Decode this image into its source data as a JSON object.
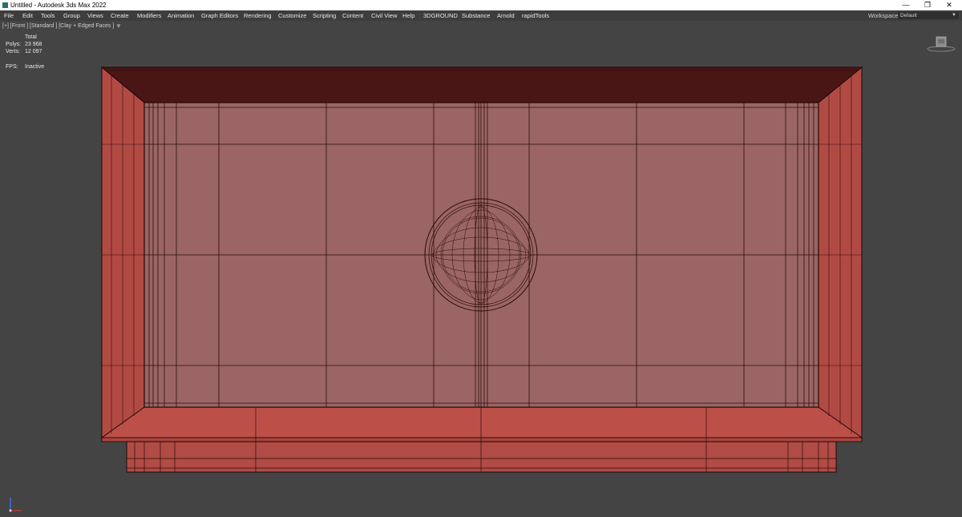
{
  "window": {
    "title": "Untitled - Autodesk 3ds Max 2022",
    "minimize_glyph": "—",
    "restore_glyph": "❐",
    "close_glyph": "✕"
  },
  "menu": {
    "items": [
      "File",
      "Edit",
      "Tools",
      "Group",
      "Views",
      "Create",
      "Modifiers",
      "Animation",
      "Graph Editors",
      "Rendering",
      "Customize",
      "Scripting",
      "Content",
      "Civil View",
      "Help",
      "3DGROUND",
      "Substance",
      "Arnold",
      "rapidTools"
    ],
    "workspaces_label": "Workspaces:",
    "workspace_value": "Default"
  },
  "viewport": {
    "label": "[+] [Front ] [Standard ] [Clay + Edged Faces ]",
    "filter_icon": "funnel-icon",
    "stats": {
      "total_label": "Total",
      "polys_label": "Polys:",
      "polys_value": "23 968",
      "verts_label": "Verts:",
      "verts_value": "12 097",
      "fps_label": "FPS:",
      "fps_value": "Inactive"
    },
    "viewcube_icon": "viewcube-icon",
    "axis_icon": "axis-tripod-icon"
  },
  "colors": {
    "viewport_bg": "#444444",
    "mesh_fill": "#9a6565",
    "mesh_dark": "#4a1a18",
    "mesh_side": "#b04c45",
    "wire": "#2a0c0a"
  }
}
